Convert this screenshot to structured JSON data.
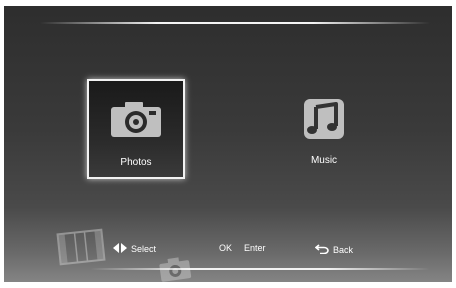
{
  "menu": {
    "items": [
      {
        "label": "Photos",
        "icon": "camera-icon",
        "selected": true
      },
      {
        "label": "Music",
        "icon": "music-note-icon",
        "selected": false
      }
    ]
  },
  "hints": {
    "select_label": "Select",
    "ok_key": "OK",
    "enter_label": "Enter",
    "back_label": "Back"
  },
  "colors": {
    "background_top": "#2d2d2d",
    "background_bottom": "#8a8a8a",
    "text": "#ffffff",
    "selection_border": "#f2f2f2"
  }
}
